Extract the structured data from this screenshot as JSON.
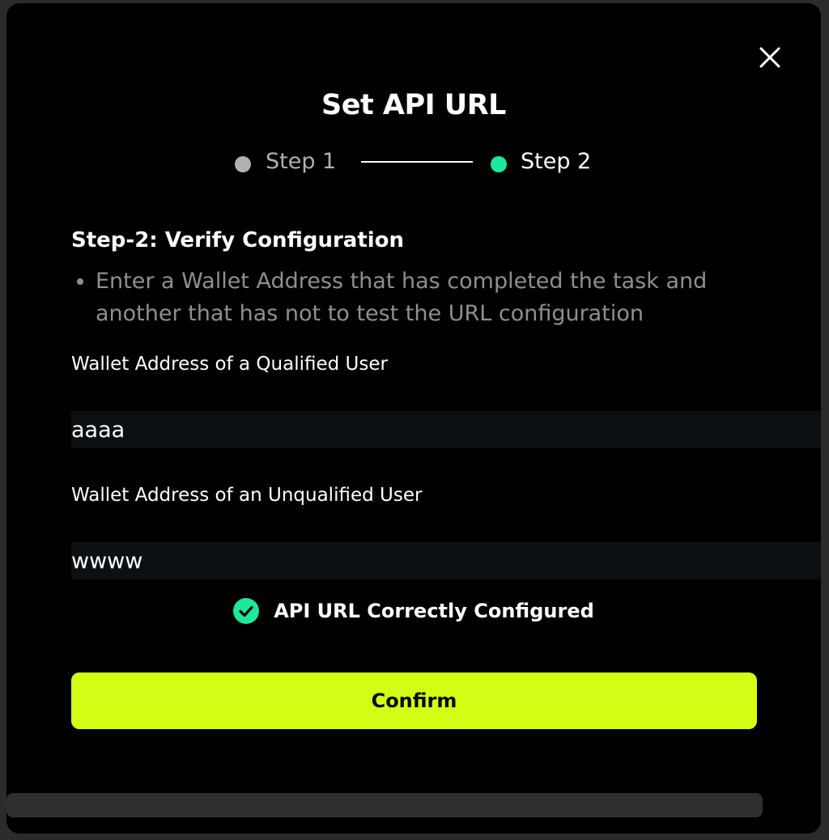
{
  "dialog": {
    "title": "Set API URL",
    "close_icon": "close-icon"
  },
  "stepper": {
    "steps": [
      {
        "label": "Step 1",
        "state": "completed",
        "color": "#b0b0b0"
      },
      {
        "label": "Step 2",
        "state": "active",
        "color": "#1ee89a"
      }
    ],
    "connector_color": "#ffffff"
  },
  "section": {
    "heading": "Step-2: Verify Configuration",
    "instructions": [
      "Enter a Wallet Address that has completed the task and another that has not to test the URL configuration"
    ]
  },
  "fields": {
    "qualified": {
      "label": "Wallet Address of a Qualified User",
      "value": "aaaa"
    },
    "unqualified": {
      "label": "Wallet Address of an Unqualified User",
      "value": "wwww"
    }
  },
  "status": {
    "icon": "check-circle-icon",
    "text": "API URL Correctly Configured",
    "color": "#1ee89a"
  },
  "actions": {
    "confirm_label": "Confirm",
    "accent_color": "#d3ff16"
  }
}
